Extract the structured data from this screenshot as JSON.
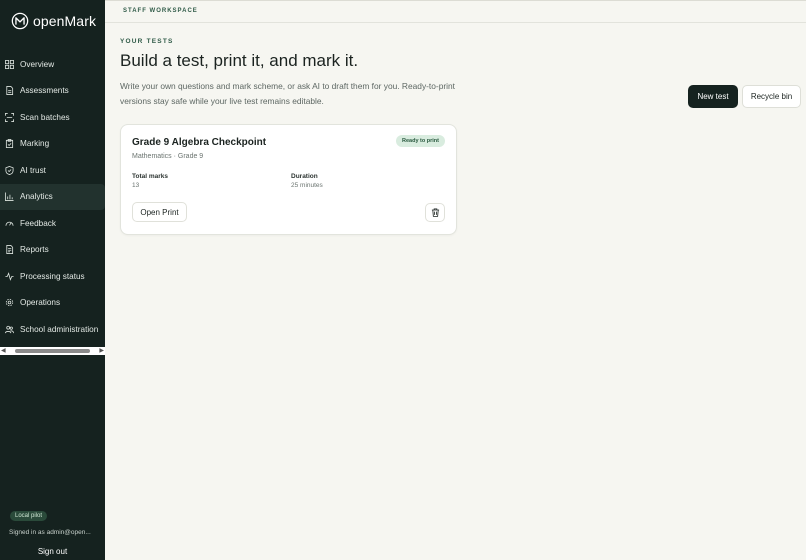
{
  "brand": {
    "name": "openMark",
    "logo_icon": "openmark-logo-icon"
  },
  "sidebar": {
    "items": [
      {
        "label": "Overview",
        "icon": "grid-icon",
        "active": false
      },
      {
        "label": "Assessments",
        "icon": "document-icon",
        "active": false
      },
      {
        "label": "Scan batches",
        "icon": "scan-icon",
        "active": false
      },
      {
        "label": "Marking",
        "icon": "clipboard-icon",
        "active": false
      },
      {
        "label": "AI trust",
        "icon": "shield-icon",
        "active": false
      },
      {
        "label": "Analytics",
        "icon": "bar-chart-icon",
        "active": true
      },
      {
        "label": "Feedback",
        "icon": "gauge-icon",
        "active": false
      },
      {
        "label": "Reports",
        "icon": "report-icon",
        "active": false
      },
      {
        "label": "Processing status",
        "icon": "activity-icon",
        "active": false
      },
      {
        "label": "Operations",
        "icon": "gear-icon",
        "active": false
      },
      {
        "label": "School administration",
        "icon": "users-icon",
        "active": false
      }
    ],
    "pilot_badge": "Local pilot",
    "signed_in": "Signed in as admin@open...",
    "sign_out": "Sign out"
  },
  "topbar": {
    "workspace": "STAFF WORKSPACE"
  },
  "main": {
    "eyebrow": "YOUR TESTS",
    "headline": "Build a test, print it, and mark it.",
    "subtitle": "Write your own questions and mark scheme, or ask AI to draft them for you. Ready-to-print versions stay safe while your live test remains editable.",
    "new_test_label": "New test",
    "recycle_label": "Recycle bin"
  },
  "card": {
    "title": "Grade 9 Algebra Checkpoint",
    "subtitle": "Mathematics · Grade 9",
    "status": "Ready to print",
    "total_marks_label": "Total marks",
    "total_marks_value": "13",
    "duration_label": "Duration",
    "duration_value": "25 minutes",
    "open_print_label": "Open Print",
    "delete_icon": "trash-icon"
  },
  "colors": {
    "sidebar_bg": "#15221f",
    "page_bg": "#f6f6f1",
    "accent_green": "#2f5a47",
    "badge_bg": "#d9ecdf"
  }
}
